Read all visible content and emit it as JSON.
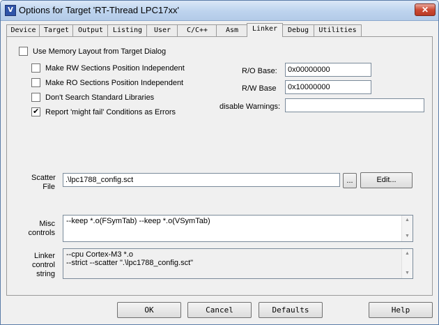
{
  "window": {
    "title": "Options for Target 'RT-Thread LPC17xx'",
    "close_glyph": "✕",
    "icon_glyph": "V"
  },
  "tabs": [
    "Device",
    "Target",
    "Output",
    "Listing",
    "User",
    "C/C++",
    "Asm",
    "Linker",
    "Debug",
    "Utilities"
  ],
  "active_tab": "Linker",
  "options": {
    "use_memory_layout": {
      "label": "Use Memory Layout from Target Dialog",
      "checked": false
    },
    "rw_independent": {
      "label": "Make RW Sections Position Independent",
      "checked": false
    },
    "ro_independent": {
      "label": "Make RO Sections Position Independent",
      "checked": false
    },
    "no_std_libs": {
      "label": "Don't Search Standard Libraries",
      "checked": false
    },
    "might_fail_errors": {
      "label": "Report 'might fail' Conditions as Errors",
      "checked": true
    }
  },
  "check_glyph": "✔",
  "ro_base": {
    "label": "R/O Base:",
    "value": "0x00000000"
  },
  "rw_base": {
    "label": "R/W Base",
    "value": "0x10000000"
  },
  "disable_warnings": {
    "label": "disable Warnings:",
    "value": ""
  },
  "scatter": {
    "label_line1": "Scatter",
    "label_line2": "File",
    "value": ".\\lpc1788_config.sct",
    "browse_label": "...",
    "edit_label": "Edit..."
  },
  "misc": {
    "label_line1": "Misc",
    "label_line2": "controls",
    "value": "--keep *.o(FSymTab) --keep *.o(VSymTab)"
  },
  "linker_control": {
    "label_line1": "Linker",
    "label_line2": "control",
    "label_line3": "string",
    "line1": "--cpu Cortex-M3 *.o",
    "line2": "--strict --scatter \".\\lpc1788_config.sct\""
  },
  "scroll_glyphs": {
    "up": "▲",
    "down": "▼"
  },
  "buttons": {
    "ok": "OK",
    "cancel": "Cancel",
    "defaults": "Defaults",
    "help": "Help"
  }
}
